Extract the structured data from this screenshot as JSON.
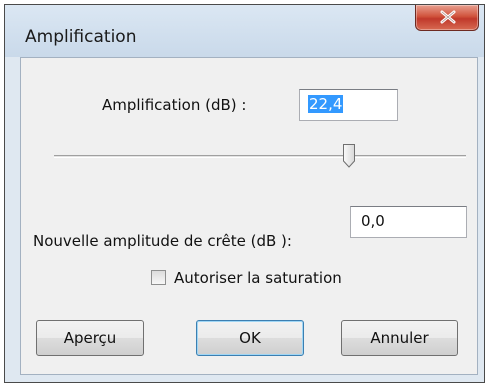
{
  "dialog": {
    "title": "Amplification",
    "close_icon": "close-icon"
  },
  "amplification": {
    "label": "Amplification (dB) :",
    "value": "22,4"
  },
  "slider": {
    "level_fraction": 0.72
  },
  "peak": {
    "label": "Nouvelle amplitude de crête (dB ):",
    "value": "0,0"
  },
  "saturation": {
    "label": "Autoriser la saturation",
    "checked": false
  },
  "buttons": {
    "preview": "Aperçu",
    "ok": "OK",
    "cancel": "Annuler"
  },
  "colors": {
    "selection": "#3399ff",
    "close_button": "#c0392b"
  }
}
